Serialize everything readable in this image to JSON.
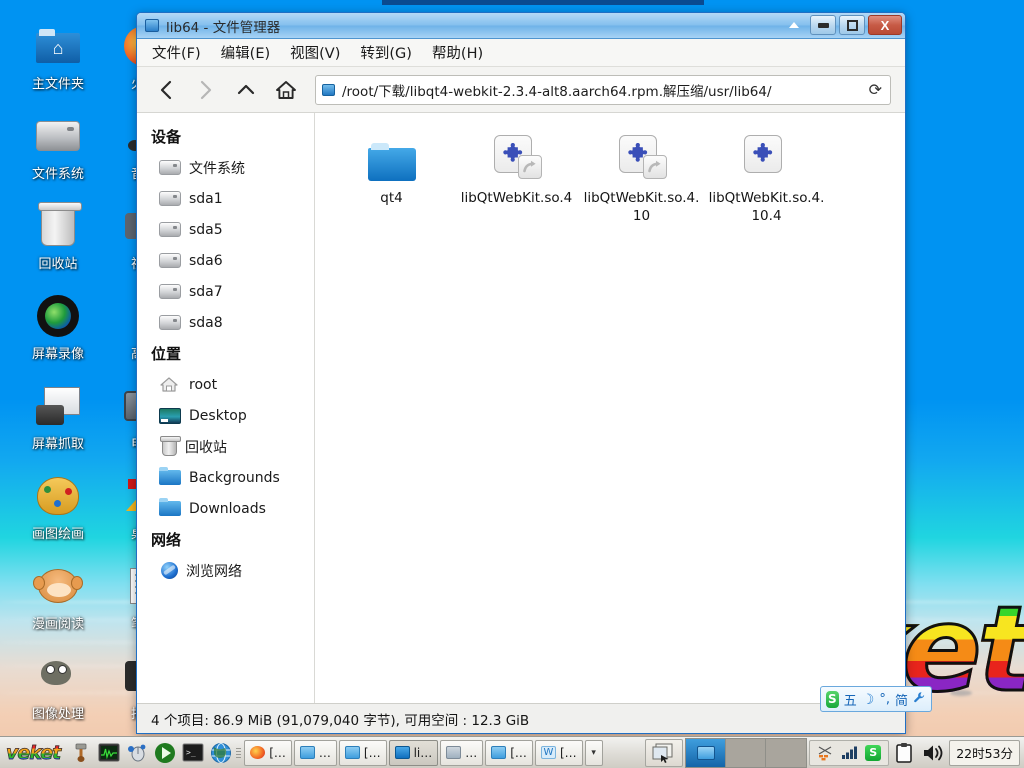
{
  "desktop": {
    "icons_col1": [
      {
        "label": "主文件夹",
        "icon": "home-folder-icon"
      },
      {
        "label": "文件系统",
        "icon": "hard-disk-icon"
      },
      {
        "label": "回收站",
        "icon": "trash-icon"
      },
      {
        "label": "屏幕录像",
        "icon": "screen-record-icon"
      },
      {
        "label": "屏幕抓取",
        "icon": "screenshot-icon"
      },
      {
        "label": "画图绘画",
        "icon": "paint-palette-icon"
      },
      {
        "label": "漫画阅读",
        "icon": "comic-reader-icon"
      },
      {
        "label": "图像处理",
        "icon": "gimp-icon"
      }
    ],
    "icons_col2": [
      {
        "label": "火狐",
        "icon": "firefox-icon"
      },
      {
        "label": "音乐",
        "icon": "music-icon"
      },
      {
        "label": "视频",
        "icon": "video-icon"
      },
      {
        "label": "高级",
        "icon": "advanced-icon"
      },
      {
        "label": "电视",
        "icon": "tv-icon"
      },
      {
        "label": "桌面",
        "icon": "desktop-icon"
      },
      {
        "label": "笔记",
        "icon": "notes-icon"
      },
      {
        "label": "拍照",
        "icon": "photo-icon"
      }
    ],
    "wallpaper_word": "veket"
  },
  "window": {
    "title": "lib64 - 文件管理器",
    "title_icon": "folder-icon",
    "controls": {
      "shade": "▲",
      "minimize": "minimize-icon",
      "maximize": "maximize-icon",
      "close": "X"
    },
    "menu": [
      {
        "label": "文件(F)"
      },
      {
        "label": "编辑(E)"
      },
      {
        "label": "视图(V)"
      },
      {
        "label": "转到(G)"
      },
      {
        "label": "帮助(H)"
      }
    ],
    "toolbar": {
      "back": "‹",
      "forward": "›",
      "up": "^",
      "home": "home-icon",
      "reload": "⟳",
      "path": "/root/下载/libqt4-webkit-2.3.4-alt8.aarch64.rpm.解压缩/usr/lib64/"
    },
    "sidebar": {
      "devices_header": "设备",
      "devices": [
        {
          "label": "文件系统",
          "icon": "drive-icon"
        },
        {
          "label": "sda1",
          "icon": "drive-icon"
        },
        {
          "label": "sda5",
          "icon": "drive-icon"
        },
        {
          "label": "sda6",
          "icon": "drive-icon"
        },
        {
          "label": "sda7",
          "icon": "drive-icon"
        },
        {
          "label": "sda8",
          "icon": "drive-icon"
        }
      ],
      "places_header": "位置",
      "places": [
        {
          "label": "root",
          "icon": "home-icon"
        },
        {
          "label": "Desktop",
          "icon": "desktop-icon"
        },
        {
          "label": "回收站",
          "icon": "trash-icon"
        },
        {
          "label": "Backgrounds",
          "icon": "folder-icon"
        },
        {
          "label": "Downloads",
          "icon": "folder-icon"
        }
      ],
      "network_header": "网络",
      "network": [
        {
          "label": "浏览网络",
          "icon": "globe-icon"
        }
      ]
    },
    "files": [
      {
        "label": "qt4",
        "type": "folder",
        "symlink": false
      },
      {
        "label": "libQtWebKit.so.4",
        "type": "library",
        "symlink": true
      },
      {
        "label": "libQtWebKit.so.4.10",
        "type": "library",
        "symlink": true
      },
      {
        "label": "libQtWebKit.so.4.10.4",
        "type": "library",
        "symlink": false
      }
    ],
    "statusbar": "4 个项目: 86.9 MiB (91,079,040 字节), 可用空间 : 12.3 GiB"
  },
  "ime": {
    "logo": "S",
    "mode": "五",
    "moon": "☽",
    "punct": "°,",
    "lang": "简",
    "tools": "wrench-icon"
  },
  "taskbar": {
    "logo": "veket",
    "quicklaunch": [
      {
        "icon": "mount-tool-icon"
      },
      {
        "icon": "system-monitor-icon"
      },
      {
        "icon": "mouse-settings-icon"
      },
      {
        "icon": "media-player-icon"
      },
      {
        "icon": "terminal-icon"
      },
      {
        "icon": "browser-icon"
      }
    ],
    "windows": [
      {
        "label": "[…",
        "icon": "firefox-icon",
        "active": false
      },
      {
        "label": "…",
        "icon": "folder-icon",
        "active": false
      },
      {
        "label": "[…",
        "icon": "folder-icon",
        "active": false
      },
      {
        "label": "li…",
        "icon": "folder-icon",
        "active": true
      },
      {
        "label": "…",
        "icon": "camera-icon",
        "active": false
      },
      {
        "label": "[…",
        "icon": "folder-icon",
        "active": false
      },
      {
        "label": "[…",
        "icon": "writer-icon",
        "active": false
      }
    ],
    "overflow_arrow": "▾",
    "show_desktop": "show-desktop-icon",
    "pager": [
      {
        "active": true
      },
      {
        "active": false
      },
      {
        "active": false
      }
    ],
    "tray": [
      {
        "icon": "network-icon"
      },
      {
        "icon": "signal-bars-icon"
      },
      {
        "icon": "sogou-icon",
        "label": "S"
      }
    ],
    "clipboard": "clipboard-icon",
    "volume": "volume-icon",
    "clock": "22时53分"
  }
}
